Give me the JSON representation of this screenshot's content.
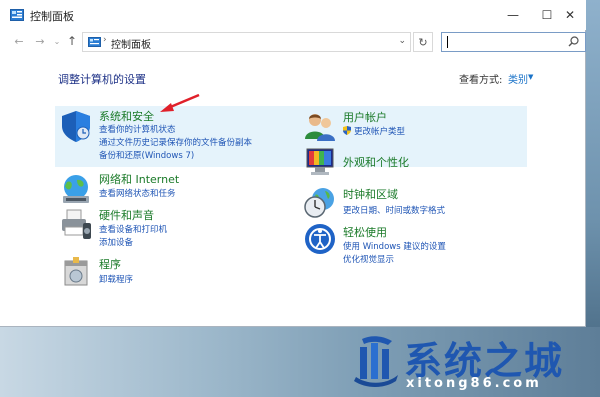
{
  "window": {
    "title": "控制面板",
    "buttons": {
      "minimize": "—",
      "maximize": "☐",
      "close": "✕"
    }
  },
  "navbar": {
    "back": "←",
    "forward": "→",
    "recent": "⌄",
    "up": "↑",
    "address_separator": "›",
    "address": "控制面板",
    "address_dropdown": "⌄",
    "refresh": "↻",
    "search_placeholder": ""
  },
  "content": {
    "heading": "调整计算机的设置",
    "view_by_label": "查看方式:",
    "view_by_value": "类别",
    "view_by_arrow": "▼"
  },
  "categories": [
    {
      "title": "系统和安全",
      "links": [
        "查看你的计算机状态",
        "通过文件历史记录保存你的文件备份副本",
        "备份和还原(Windows 7)"
      ],
      "icon": "shield-icon"
    },
    {
      "title": "网络和 Internet",
      "links": [
        "查看网络状态和任务"
      ],
      "icon": "network-globe-icon"
    },
    {
      "title": "硬件和声音",
      "links": [
        "查看设备和打印机",
        "添加设备"
      ],
      "icon": "printer-icon"
    },
    {
      "title": "程序",
      "links": [
        "卸载程序"
      ],
      "icon": "programs-icon"
    },
    {
      "title": "用户帐户",
      "links": [
        "更改帐户类型"
      ],
      "icon": "users-icon"
    },
    {
      "title": "外观和个性化",
      "links": [],
      "icon": "appearance-icon"
    },
    {
      "title": "时钟和区域",
      "links": [
        "更改日期、时间或数字格式"
      ],
      "icon": "clock-globe-icon"
    },
    {
      "title": "轻松使用",
      "links": [
        "使用 Windows 建议的设置",
        "优化视觉显示"
      ],
      "icon": "ease-of-access-icon"
    }
  ],
  "watermark": {
    "text": "系统之城",
    "url": "xitong86.com"
  },
  "colors": {
    "link": "#1f55b5",
    "category_title": "#1a7a28",
    "heading": "#1e3287",
    "highlight": "#e5f3fb",
    "annotation_arrow": "#e0202a",
    "watermark": "#1f57b0"
  }
}
